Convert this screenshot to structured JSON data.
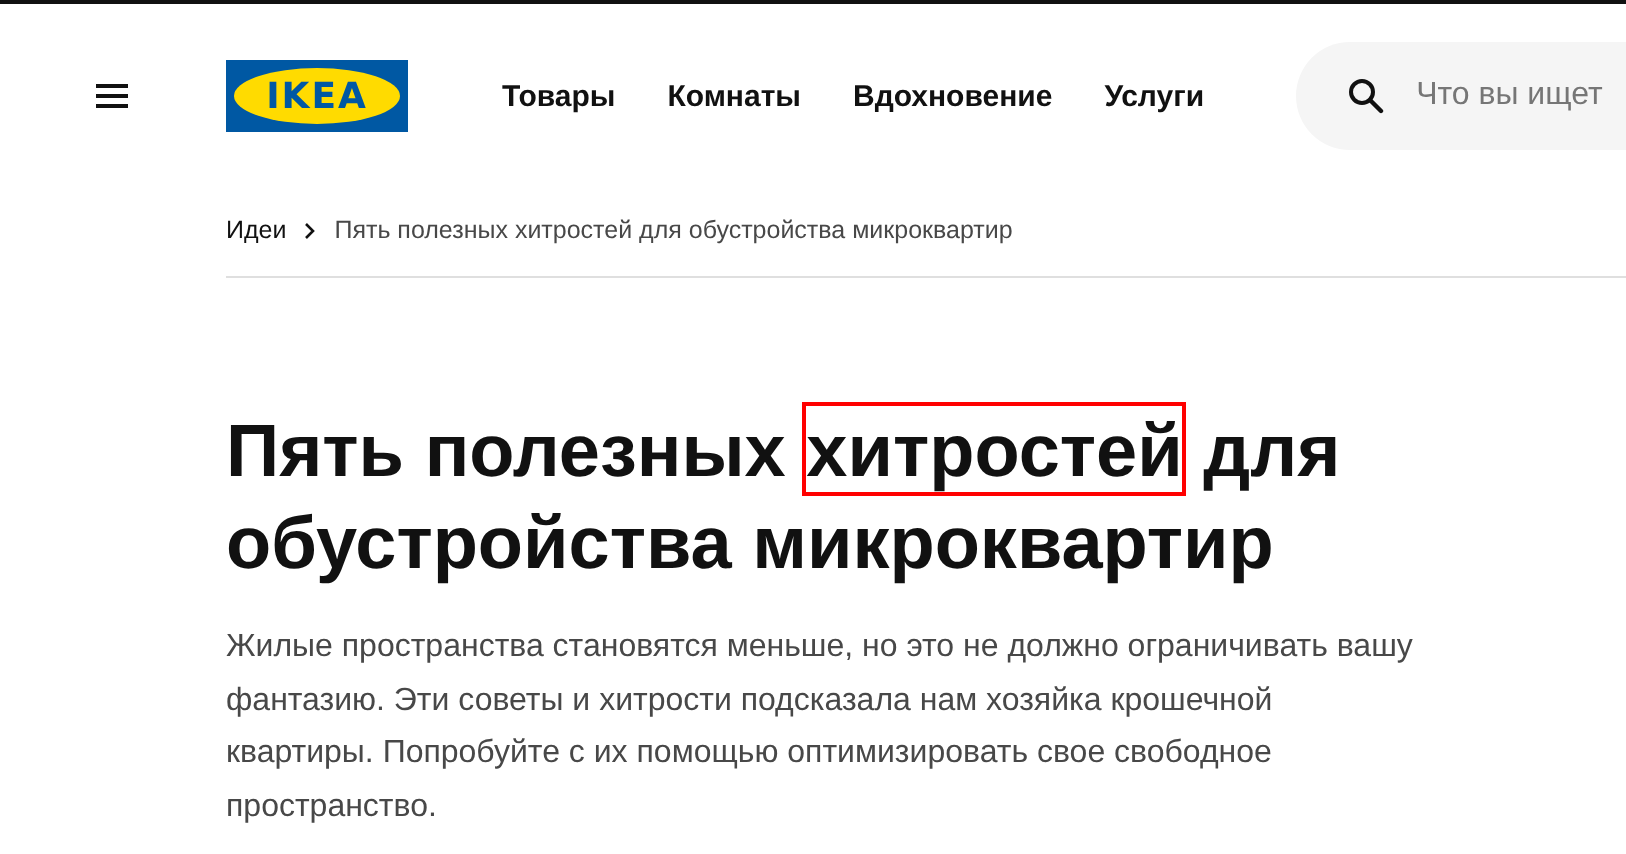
{
  "header": {
    "logo": {
      "text": "IKEA"
    },
    "nav": [
      {
        "label": "Товары"
      },
      {
        "label": "Комнаты"
      },
      {
        "label": "Вдохновение"
      },
      {
        "label": "Услуги"
      }
    ],
    "search": {
      "placeholder": "Что вы ищет"
    }
  },
  "breadcrumb": [
    {
      "label": "Идеи"
    },
    {
      "label": "Пять полезных хитростей для обустройства микроквартир"
    }
  ],
  "title": {
    "lead": "Пять полезных ",
    "highlight": "хитростей",
    "tail": " для обустройства микроквартир"
  },
  "intro": "Жилые пространства становятся меньше, но это не должно ограничивать вашу фантазию. Эти советы и хитрости подсказала нам хозяйка крошечной квартиры. Попробуйте с их помощью оптимизировать свое свободное пространство."
}
